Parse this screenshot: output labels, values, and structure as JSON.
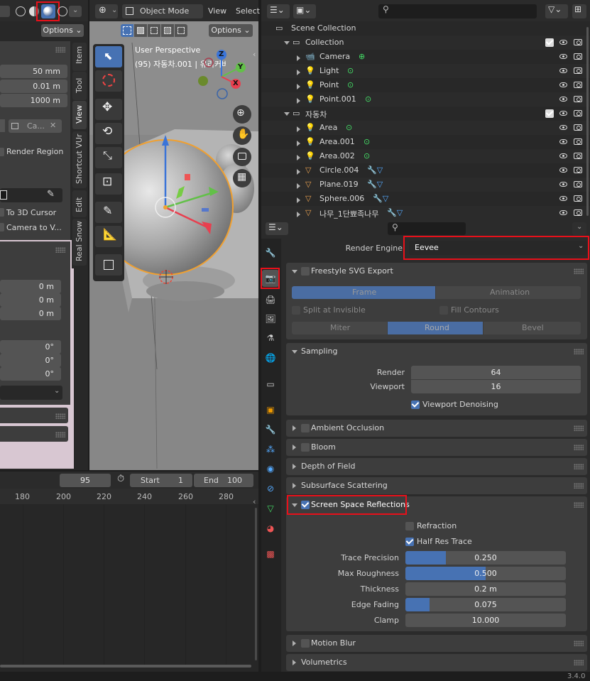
{
  "version": "3.4.0",
  "left_panel": {
    "options_label": "Options",
    "fields_dim": [
      "50 mm",
      "0.01 m",
      "1000 m"
    ],
    "camera_field": "Ca...",
    "render_region": "Render Region",
    "to_3d_cursor": "To 3D Cursor",
    "camera_to_view": "Camera to V...",
    "loc_fields": [
      "0 m",
      "0 m",
      "0 m"
    ],
    "rot_fields": [
      "0°",
      "0°",
      "0°"
    ],
    "vtabs": [
      "Item",
      "Tool",
      "View",
      "Shortcut VUr",
      "Edit",
      "Real Snow"
    ]
  },
  "viewport": {
    "mode": "Object Mode",
    "menu_view": "View",
    "menu_select": "Select",
    "options_label": "Options",
    "perspective": "User Perspective",
    "object_info": "(95) 자동차.001 | 유리커버",
    "axis": {
      "x": "X",
      "y": "Y",
      "z": "Z"
    }
  },
  "timeline": {
    "current_frame": "95",
    "start_label": "Start",
    "start_value": "1",
    "end_label": "End",
    "end_value": "100",
    "ticks": [
      "180",
      "200",
      "220",
      "240",
      "260",
      "280"
    ]
  },
  "outliner": {
    "rows": [
      {
        "name": "Scene Collection",
        "type": "scene"
      },
      {
        "name": "Collection",
        "type": "collection"
      },
      {
        "name": "Camera",
        "type": "camera"
      },
      {
        "name": "Light",
        "type": "light"
      },
      {
        "name": "Point",
        "type": "light"
      },
      {
        "name": "Point.001",
        "type": "light"
      },
      {
        "name": "자동차",
        "type": "collection"
      },
      {
        "name": "Area",
        "type": "light"
      },
      {
        "name": "Area.001",
        "type": "light"
      },
      {
        "name": "Area.002",
        "type": "light"
      },
      {
        "name": "Circle.004",
        "type": "mesh"
      },
      {
        "name": "Plane.019",
        "type": "mesh"
      },
      {
        "name": "Sphere.006",
        "type": "mesh"
      },
      {
        "name": "나무_1단뾰족나무",
        "type": "mesh"
      }
    ]
  },
  "properties": {
    "render_engine_label": "Render Engine",
    "render_engine_value": "Eevee",
    "freestyle": {
      "title": "Freestyle SVG Export",
      "frame": "Frame",
      "animation": "Animation",
      "split_at_invisible": "Split at Invisible",
      "fill_contours": "Fill Contours",
      "miter": "Miter",
      "round": "Round",
      "bevel": "Bevel"
    },
    "sampling": {
      "title": "Sampling",
      "render_label": "Render",
      "render_value": "64",
      "viewport_label": "Viewport",
      "viewport_value": "16",
      "denoise_label": "Viewport Denoising"
    },
    "panels_collapsed_top": [
      "Ambient Occlusion",
      "Bloom",
      "Depth of Field",
      "Subsurface Scattering"
    ],
    "ssr": {
      "title": "Screen Space Reflections",
      "refraction": "Refraction",
      "half_res": "Half Res Trace",
      "sliders": [
        {
          "label": "Trace Precision",
          "value": "0.250",
          "fill": 0.25
        },
        {
          "label": "Max Roughness",
          "value": "0.500",
          "fill": 0.5
        },
        {
          "label": "Thickness",
          "value": "0.2 m",
          "fill": 0
        },
        {
          "label": "Edge Fading",
          "value": "0.075",
          "fill": 0.15
        },
        {
          "label": "Clamp",
          "value": "10.000",
          "fill": 0
        }
      ]
    },
    "panels_collapsed_bottom": [
      "Motion Blur",
      "Volumetrics"
    ]
  },
  "colors": {
    "accent": "#4772b3",
    "highlight_box": "#e8101a",
    "selected_orange": "#f0a030"
  }
}
